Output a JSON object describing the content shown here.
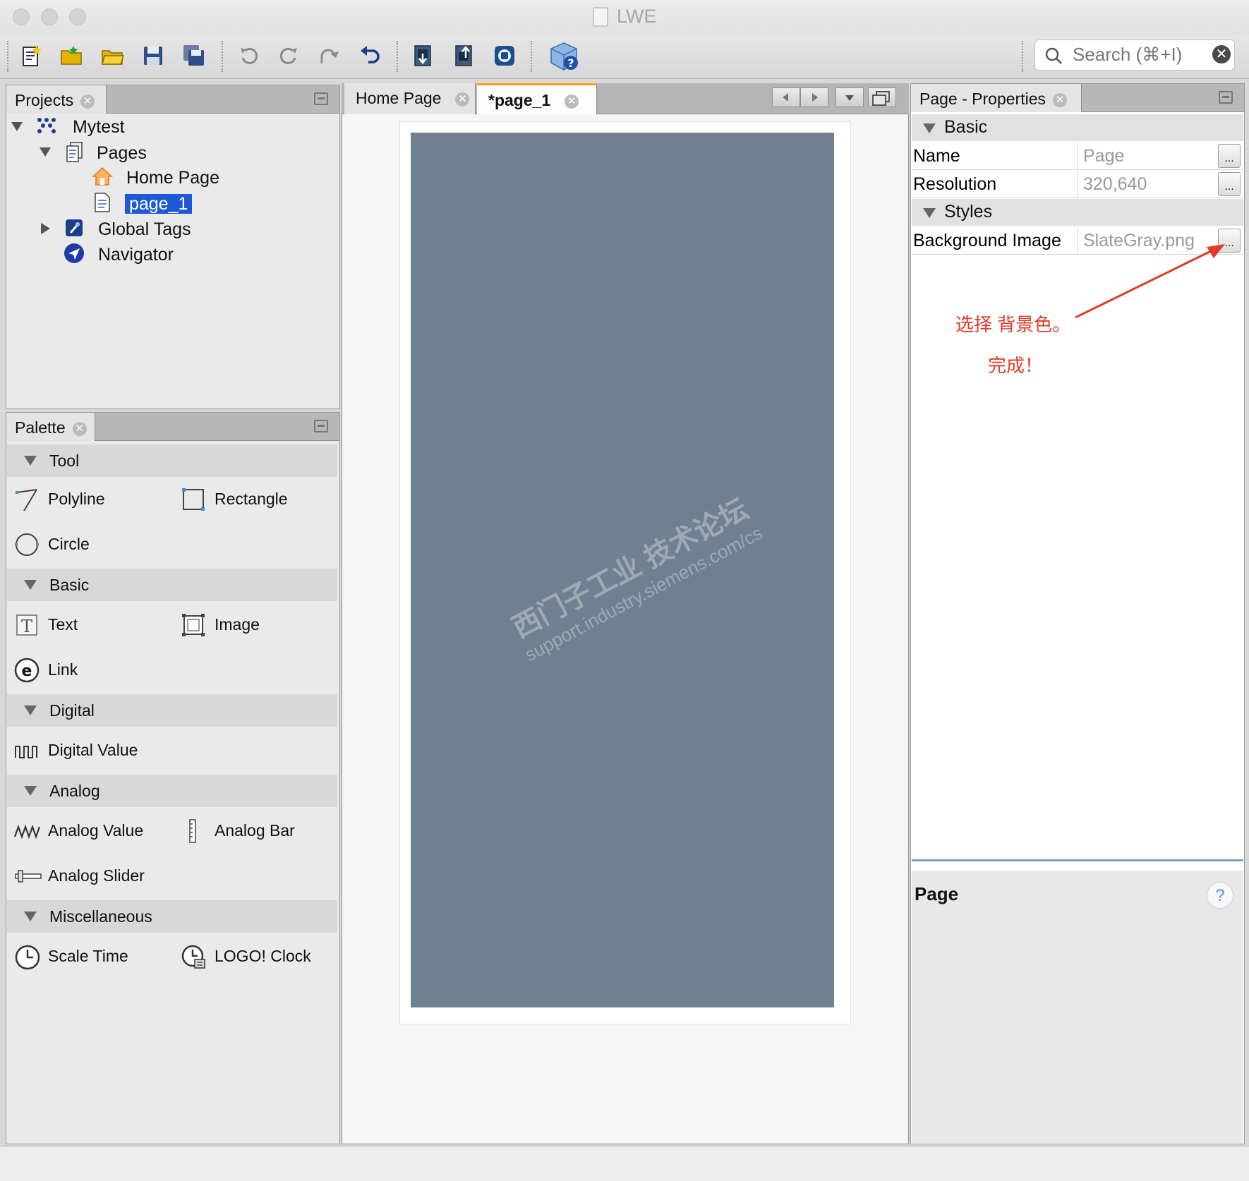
{
  "window": {
    "title": "LWE"
  },
  "search": {
    "placeholder": "Search (⌘+I)"
  },
  "toolbar": {
    "buttons": [
      "new-project-icon",
      "new-folder-icon",
      "open-folder-icon",
      "save-icon",
      "save-all-icon",
      "undo-icon",
      "redo-icon",
      "redo-alt-icon",
      "revert-icon",
      "download-icon",
      "upload-icon",
      "simulate-icon",
      "help-icon"
    ]
  },
  "projects_panel": {
    "tab_label": "Projects",
    "tree": {
      "root": "Mytest",
      "pages_label": "Pages",
      "home_page": "Home Page",
      "page_1": "page_1",
      "global_tags": "Global Tags",
      "navigator": "Navigator"
    }
  },
  "palette": {
    "tab_label": "Palette",
    "sections": {
      "tool": "Tool",
      "basic": "Basic",
      "digital": "Digital",
      "analog": "Analog",
      "misc": "Miscellaneous"
    },
    "items": {
      "polyline": "Polyline",
      "rectangle": "Rectangle",
      "circle": "Circle",
      "text": "Text",
      "image": "Image",
      "link": "Link",
      "digital_value": "Digital Value",
      "analog_value": "Analog Value",
      "analog_bar": "Analog Bar",
      "analog_slider": "Analog Slider",
      "scale_time": "Scale Time",
      "logo_clock": "LOGO! Clock"
    }
  },
  "editor": {
    "tabs": [
      "Home Page",
      "*page_1"
    ],
    "active_tab": "*page_1",
    "canvas_color": "#708090",
    "watermark_line1": "西门子工业  技术论坛",
    "watermark_line2": "support.industry.siemens.com/cs"
  },
  "properties": {
    "tab_label": "Page - Properties",
    "section_basic": "Basic",
    "section_styles": "Styles",
    "rows": {
      "name": {
        "key": "Name",
        "value": "Page"
      },
      "resolution": {
        "key": "Resolution",
        "value": "320,640"
      },
      "background": {
        "key": "Background Image",
        "value": "SlateGray.png"
      }
    },
    "ellipsis": "...",
    "footer_title": "Page",
    "help_glyph": "?"
  },
  "annotation": {
    "line1": "选择 背景色。",
    "line2": "完成！",
    "color": "#e23b26"
  }
}
